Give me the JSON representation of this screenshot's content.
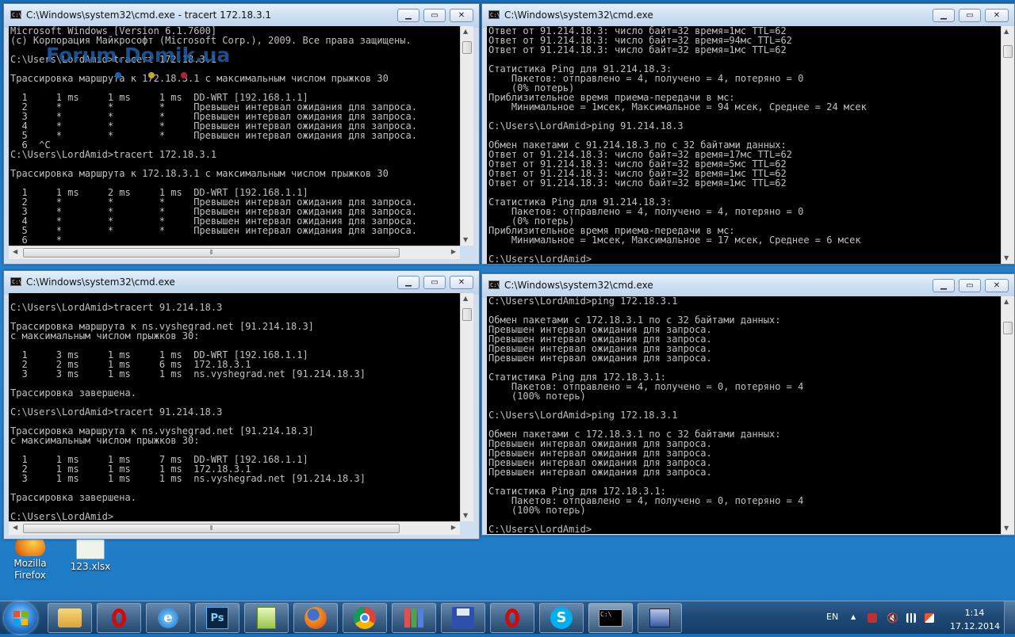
{
  "watermark": "Forum.Domik.ua",
  "windows": [
    {
      "title": "C:\\Windows\\system32\\cmd.exe - tracert  172.18.3.1",
      "lines": [
        "Microsoft Windows [Version 6.1.7600]",
        "(c) Корпорация Майкрософт (Microsoft Corp.), 2009. Все права защищены.",
        "",
        "C:\\Users\\LordAmid>tracert 172.18.3.1",
        "",
        "Трассировка маршрута к 172.18.3.1 с максимальным числом прыжков 30",
        "",
        "  1     1 ms     1 ms     1 ms  DD-WRT [192.168.1.1]",
        "  2     *        *        *     Превышен интервал ожидания для запроса.",
        "  3     *        *        *     Превышен интервал ожидания для запроса.",
        "  4     *        *        *     Превышен интервал ожидания для запроса.",
        "  5     *        *        *     Превышен интервал ожидания для запроса.",
        "  6  ^C",
        "C:\\Users\\LordAmid>tracert 172.18.3.1",
        "",
        "Трассировка маршрута к 172.18.3.1 с максимальным числом прыжков 30",
        "",
        "  1     1 ms     2 ms     1 ms  DD-WRT [192.168.1.1]",
        "  2     *        *        *     Превышен интервал ожидания для запроса.",
        "  3     *        *        *     Превышен интервал ожидания для запроса.",
        "  4     *        *        *     Превышен интервал ожидания для запроса.",
        "  5     *        *        *     Превышен интервал ожидания для запроса.",
        "  6     *"
      ]
    },
    {
      "title": "C:\\Windows\\system32\\cmd.exe",
      "lines": [
        "Ответ от 91.214.18.3: число байт=32 время=1мс TTL=62",
        "Ответ от 91.214.18.3: число байт=32 время=94мс TTL=62",
        "Ответ от 91.214.18.3: число байт=32 время=1мс TTL=62",
        "",
        "Статистика Ping для 91.214.18.3:",
        "    Пакетов: отправлено = 4, получено = 4, потеряно = 0",
        "    (0% потерь)",
        "Приблизительное время приема-передачи в мс:",
        "    Минимальное = 1мсек, Максимальное = 94 мсек, Среднее = 24 мсек",
        "",
        "C:\\Users\\LordAmid>ping 91.214.18.3",
        "",
        "Обмен пакетами с 91.214.18.3 по с 32 байтами данных:",
        "Ответ от 91.214.18.3: число байт=32 время=17мс TTL=62",
        "Ответ от 91.214.18.3: число байт=32 время=5мс TTL=62",
        "Ответ от 91.214.18.3: число байт=32 время=1мс TTL=62",
        "Ответ от 91.214.18.3: число байт=32 время=1мс TTL=62",
        "",
        "Статистика Ping для 91.214.18.3:",
        "    Пакетов: отправлено = 4, получено = 4, потеряно = 0",
        "    (0% потерь)",
        "Приблизительное время приема-передачи в мс:",
        "    Минимальное = 1мсек, Максимальное = 17 мсек, Среднее = 6 мсек",
        "",
        "C:\\Users\\LordAmid>"
      ]
    },
    {
      "title": "C:\\Windows\\system32\\cmd.exe",
      "lines": [
        "",
        "C:\\Users\\LordAmid>tracert 91.214.18.3",
        "",
        "Трассировка маршрута к ns.vyshegrad.net [91.214.18.3]",
        "с максимальным числом прыжков 30:",
        "",
        "  1     3 ms     1 ms     1 ms  DD-WRT [192.168.1.1]",
        "  2     2 ms     1 ms     6 ms  172.18.3.1",
        "  3     3 ms     1 ms     1 ms  ns.vyshegrad.net [91.214.18.3]",
        "",
        "Трассировка завершена.",
        "",
        "C:\\Users\\LordAmid>tracert 91.214.18.3",
        "",
        "Трассировка маршрута к ns.vyshegrad.net [91.214.18.3]",
        "с максимальным числом прыжков 30:",
        "",
        "  1     1 ms     1 ms     7 ms  DD-WRT [192.168.1.1]",
        "  2     1 ms     1 ms     1 ms  172.18.3.1",
        "  3     1 ms     1 ms     1 ms  ns.vyshegrad.net [91.214.18.3]",
        "",
        "Трассировка завершена.",
        "",
        "C:\\Users\\LordAmid>"
      ]
    },
    {
      "title": "C:\\Windows\\system32\\cmd.exe",
      "lines": [
        "C:\\Users\\LordAmid>ping 172.18.3.1",
        "",
        "Обмен пакетами с 172.18.3.1 по с 32 байтами данных:",
        "Превышен интервал ожидания для запроса.",
        "Превышен интервал ожидания для запроса.",
        "Превышен интервал ожидания для запроса.",
        "Превышен интервал ожидания для запроса.",
        "",
        "Статистика Ping для 172.18.3.1:",
        "    Пакетов: отправлено = 4, получено = 0, потеряно = 4",
        "    (100% потерь)",
        "",
        "C:\\Users\\LordAmid>ping 172.18.3.1",
        "",
        "Обмен пакетами с 172.18.3.1 по с 32 байтами данных:",
        "Превышен интервал ожидания для запроса.",
        "Превышен интервал ожидания для запроса.",
        "Превышен интервал ожидания для запроса.",
        "Превышен интервал ожидания для запроса.",
        "",
        "Статистика Ping для 172.18.3.1:",
        "    Пакетов: отправлено = 4, получено = 0, потеряно = 4",
        "    (100% потерь)",
        "",
        "C:\\Users\\LordAmid>"
      ]
    }
  ],
  "window_icon_text": "C:\\",
  "desktop": [
    {
      "label": "Mozilla\nFirefox",
      "icon": "firefox-icon"
    },
    {
      "label": "123.xlsx",
      "icon": "excel-file-icon"
    }
  ],
  "taskbar": {
    "items": [
      "explorer-icon",
      "opera-icon",
      "internet-explorer-icon",
      "photoshop-icon",
      "notepad-plus-plus-icon",
      "firefox-icon",
      "chrome-icon",
      "apps-grid-icon",
      "save-floppy-icon",
      "opera-icon",
      "skype-icon",
      "cmd-icon",
      "network-manager-icon"
    ],
    "lang": "EN",
    "time": "1:14",
    "date": "17.12.2014"
  },
  "colors": {
    "console_bg": "#000000",
    "console_fg": "#c0c0c0",
    "desktop": "#2a86cf"
  }
}
